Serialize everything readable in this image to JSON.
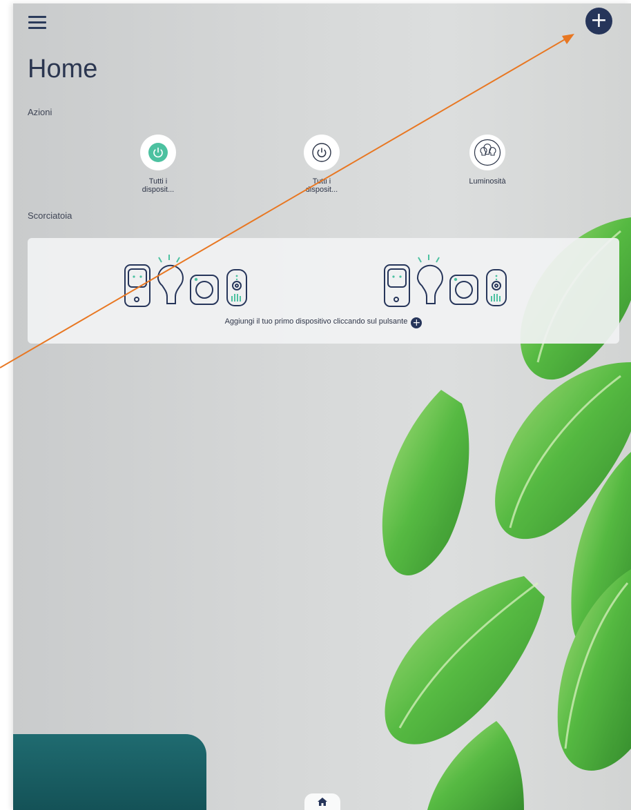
{
  "header": {
    "menu_icon": "hamburger-icon",
    "add_icon": "plus-icon",
    "add_symbol": "+"
  },
  "page": {
    "title": "Home"
  },
  "actions": {
    "section_label": "Azioni",
    "items": [
      {
        "label": "Tutti i\ndisposit...",
        "icon": "power-icon",
        "style": "green"
      },
      {
        "label": "Tutti i\ndisposit...",
        "icon": "power-icon",
        "style": "outline"
      },
      {
        "label": "Luminosità",
        "icon": "bulbs-icon",
        "style": "outline"
      }
    ]
  },
  "shortcuts": {
    "section_label": "Scorciatoia",
    "empty_message": "Aggiungi il tuo primo dispositivo cliccando sul pulsante",
    "inline_plus": "+"
  },
  "bottom_nav": {
    "home_icon": "home-icon"
  },
  "colors": {
    "accent": "#4cc1a0",
    "navy": "#26355a",
    "annotation_arrow": "#e87722"
  }
}
